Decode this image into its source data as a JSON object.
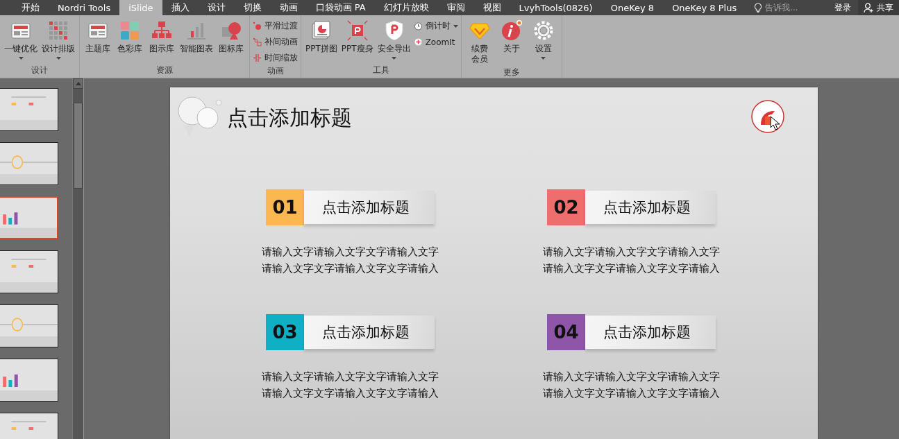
{
  "tabs": [
    {
      "label": "开始",
      "selected": false
    },
    {
      "label": "Nordri Tools",
      "selected": false
    },
    {
      "label": "iSlide",
      "selected": true
    },
    {
      "label": "插入",
      "selected": false
    },
    {
      "label": "设计",
      "selected": false
    },
    {
      "label": "切换",
      "selected": false
    },
    {
      "label": "动画",
      "selected": false
    },
    {
      "label": "口袋动画 PA",
      "selected": false
    },
    {
      "label": "幻灯片放映",
      "selected": false
    },
    {
      "label": "审阅",
      "selected": false
    },
    {
      "label": "视图",
      "selected": false
    },
    {
      "label": "LvyhTools(0826)",
      "selected": false
    },
    {
      "label": "OneKey 8",
      "selected": false
    },
    {
      "label": "OneKey 8 Plus",
      "selected": false
    }
  ],
  "tell_me": {
    "placeholder": "告诉我..."
  },
  "sign_in": "登录",
  "share": "共享",
  "ribbon": [
    {
      "label": "设计",
      "items": [
        {
          "kind": "large",
          "label": "一键优化",
          "dropdown": true
        },
        {
          "kind": "large",
          "label": "设计排版",
          "dropdown": true
        }
      ]
    },
    {
      "label": "资源",
      "items": [
        {
          "kind": "large",
          "label": "主题库",
          "dropdown": false
        },
        {
          "kind": "large",
          "label": "色彩库",
          "dropdown": false
        },
        {
          "kind": "large",
          "label": "图示库",
          "dropdown": false
        },
        {
          "kind": "large",
          "label": "智能图表",
          "dropdown": false
        },
        {
          "kind": "large",
          "label": "图标库",
          "dropdown": false
        }
      ]
    },
    {
      "label": "动画",
      "items": [
        {
          "kind": "small",
          "label": "平滑过渡",
          "dropdown": false
        },
        {
          "kind": "small",
          "label": "补间动画",
          "dropdown": false
        },
        {
          "kind": "small",
          "label": "时间缩放",
          "dropdown": false
        }
      ]
    },
    {
      "label": "工具",
      "items": [
        {
          "kind": "large",
          "label": "PPT拼图",
          "dropdown": false
        },
        {
          "kind": "large",
          "label": "PPT瘦身",
          "dropdown": false
        },
        {
          "kind": "large",
          "label": "安全导出",
          "dropdown": true
        },
        {
          "kind": "small",
          "label": "倒计时",
          "dropdown": true
        },
        {
          "kind": "small",
          "label": "ZoomIt",
          "dropdown": false
        }
      ]
    },
    {
      "label": "更多",
      "items": [
        {
          "kind": "narrow",
          "label": "续费会员",
          "dropdown": false
        },
        {
          "kind": "large",
          "label": "关于",
          "dropdown": false
        },
        {
          "kind": "large",
          "label": "设置",
          "dropdown": true
        }
      ]
    }
  ],
  "thumbnails": [
    {
      "selected": false
    },
    {
      "selected": false
    },
    {
      "selected": true
    },
    {
      "selected": false
    },
    {
      "selected": false
    },
    {
      "selected": false
    },
    {
      "selected": false
    }
  ],
  "slide": {
    "title": "点击添加标题",
    "items": [
      {
        "number": "01",
        "color": "#fbb851",
        "title": "点击添加标题",
        "lines": [
          "请输入文字请输入文字文字请输入文字",
          "请输入文字文字请输入文字文字请输入"
        ]
      },
      {
        "number": "02",
        "color": "#ee6e6e",
        "title": "点击添加标题",
        "lines": [
          "请输入文字请输入文字文字请输入文字",
          "请输入文字文字请输入文字文字请输入"
        ]
      },
      {
        "number": "03",
        "color": "#0fb0c4",
        "title": "点击添加标题",
        "lines": [
          "请输入文字请输入文字文字请输入文字",
          "请输入文字文字请输入文字文字请输入"
        ]
      },
      {
        "number": "04",
        "color": "#8e55a9",
        "title": "点击添加标题",
        "lines": [
          "请输入文字请输入文字文字请输入文字",
          "请输入文字文字请输入文字文字请输入"
        ]
      }
    ]
  }
}
